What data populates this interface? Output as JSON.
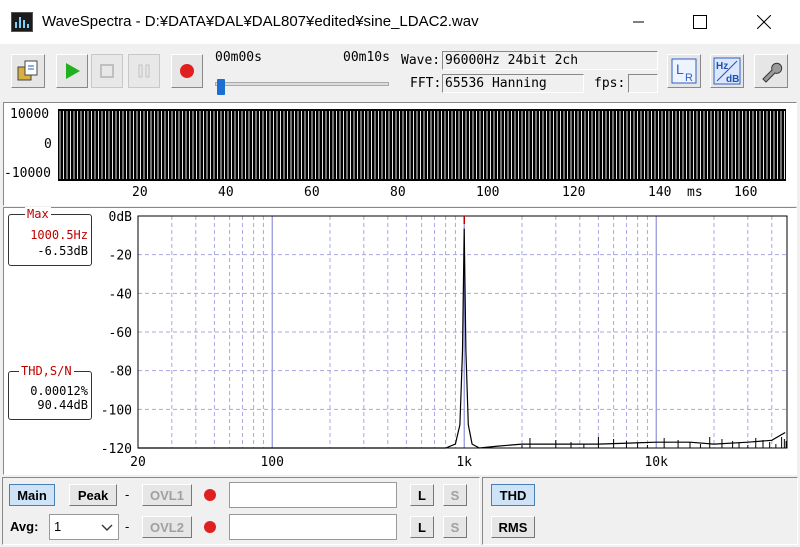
{
  "window": {
    "title": "WaveSpectra - D:¥DATA¥DAL¥DAL807¥edited¥sine_LDAC2.wav",
    "controls": [
      "minimize-icon",
      "maximize-icon",
      "close-icon"
    ]
  },
  "toolbar": {
    "time_start": "00m00s",
    "time_end": "00m10s",
    "progress": 0.01,
    "wave_label": "Wave:",
    "wave_value": "96000Hz 24bit 2ch",
    "fft_label": "FFT:",
    "fft_value": "65536 Hanning",
    "fps_label": "fps:",
    "fps_value": "",
    "icons": [
      "open-file-icon",
      "play-icon",
      "stop-icon",
      "pause-icon",
      "record-icon",
      "channel-lr-icon",
      "hz-db-scale-icon",
      "settings-wrench-icon"
    ],
    "colors": {
      "play": "#20b020",
      "record": "#e02020"
    }
  },
  "waveform": {
    "y_ticks": [
      "10000",
      "0",
      "-10000"
    ],
    "x_ticks": [
      "20",
      "40",
      "60",
      "80",
      "100",
      "120",
      "140",
      "160"
    ],
    "x_unit": "ms"
  },
  "spectrum": {
    "max_label": "Max",
    "max_freq": "1000.5Hz",
    "max_level": "-6.53dB",
    "thd_label": "THD,S/N",
    "thd_value": "0.00012%",
    "sn_value": "90.44dB",
    "label_color": "#c00000"
  },
  "chart_data": {
    "type": "line",
    "title": "",
    "xlabel": "",
    "ylabel": "",
    "x_scale": "log",
    "xlim": [
      20,
      48000
    ],
    "ylim": [
      -120,
      0
    ],
    "x_tick_labels": [
      "20",
      "100",
      "1k",
      "10k"
    ],
    "y_tick_labels": [
      "0dB",
      "-20",
      "-40",
      "-60",
      "-80",
      "-100",
      "-120"
    ],
    "grid": true,
    "series": [
      {
        "values_x": [
          20,
          800,
          900,
          950,
          980,
          1000.5,
          1020,
          1050,
          1100,
          1200,
          1500,
          2000,
          3000,
          5000,
          10000,
          15000,
          20000,
          30000,
          40000,
          47000
        ],
        "values_y": [
          -120,
          -120,
          -118,
          -108,
          -70,
          -6.53,
          -70,
          -108,
          -118,
          -120,
          -119,
          -118,
          -118,
          -118,
          -117,
          -117,
          -118,
          -117,
          -116,
          -112
        ]
      }
    ]
  },
  "bottom": {
    "main_label": "Main",
    "peak_label": "Peak",
    "dash": "-",
    "ovl1_label": "OVL1",
    "ovl2_label": "OVL2",
    "l_label": "L",
    "s_label": "S",
    "thd_label": "THD",
    "rms_label": "RMS",
    "avg_label": "Avg:",
    "avg_value": "1"
  }
}
